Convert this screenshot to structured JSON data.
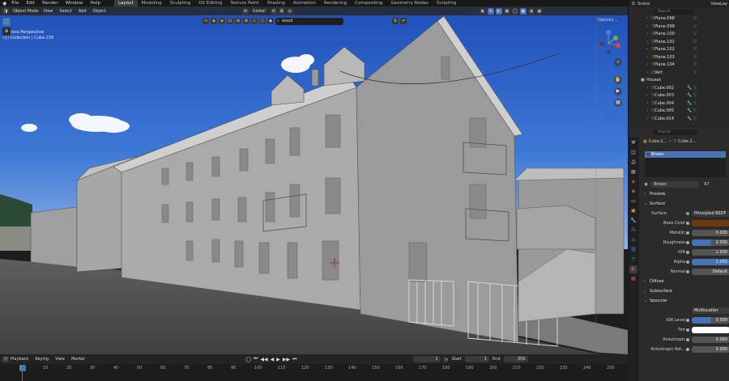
{
  "app": {
    "menus": [
      "File",
      "Edit",
      "Render",
      "Window",
      "Help"
    ],
    "workspaces": [
      "Layout",
      "Modeling",
      "Sculpting",
      "UV Editing",
      "Texture Paint",
      "Shading",
      "Animation",
      "Rendering",
      "Compositing",
      "Geometry Nodes",
      "Scripting"
    ],
    "active_workspace": "Layout",
    "scene_label": "Scene",
    "viewlayer_label": "ViewLay"
  },
  "viewport": {
    "mode": "Object Mode",
    "menus": [
      "View",
      "Select",
      "Add",
      "Object"
    ],
    "transform_orientation": "Global",
    "search_value": "wood",
    "view_name": "Camera Perspective",
    "collection_info": "(1) Collection | Cube.239",
    "options_label": "Options"
  },
  "timeline": {
    "menus": [
      "Playback",
      "Keying",
      "View",
      "Marker"
    ],
    "current_frame": "1",
    "start_label": "Start",
    "start_value": "1",
    "end_label": "End",
    "end_value": "250",
    "ticks": [
      "1",
      "10",
      "20",
      "30",
      "40",
      "50",
      "60",
      "70",
      "80",
      "90",
      "100",
      "110",
      "120",
      "130",
      "140",
      "150",
      "160",
      "170",
      "180",
      "190",
      "200",
      "210",
      "220",
      "230",
      "240",
      "250"
    ]
  },
  "outliner": {
    "objects_top": [
      "Plane.098",
      "Plane.099",
      "Plane.100",
      "Plane.101",
      "Plane.102",
      "Plane.103",
      "Plane.104",
      "Vert"
    ],
    "collection_name": "Houses",
    "objects_houses": [
      "Cube.002",
      "Cube.003",
      "Cube.004",
      "Cube.005",
      "Cube.014"
    ],
    "search_placeholder": "Search"
  },
  "properties": {
    "search_placeholder": "Search",
    "breadcrumb_object": "Cube.2...",
    "breadcrumb_mesh": "Cube.2...",
    "material_slot": "Brown",
    "material_name": "Brown",
    "user_count": "67",
    "sections": {
      "preview": "Preview",
      "surface": "Surface",
      "diffuse": "Diffuse",
      "subsurface": "Subsurface",
      "specular": "Specular"
    },
    "surface_shader": "Principled BSDF",
    "fields": [
      {
        "label": "Base Color",
        "value": "",
        "fill": 0,
        "kind": "color",
        "color": "#6b3b10"
      },
      {
        "label": "Metallic",
        "value": "0.000",
        "fill": 0,
        "kind": "value"
      },
      {
        "label": "Roughness",
        "value": "0.500",
        "fill": 50,
        "kind": "value"
      },
      {
        "label": "IOR",
        "value": "1.500",
        "fill": 0,
        "kind": "value"
      },
      {
        "label": "Alpha",
        "value": "1.000",
        "fill": 100,
        "kind": "value"
      },
      {
        "label": "Normal",
        "value": "Default",
        "fill": 0,
        "kind": "value"
      }
    ],
    "specular_distribution": "Multiscatter GGX",
    "specular_fields": [
      {
        "label": "IOR Level",
        "value": "0.500",
        "fill": 50,
        "kind": "value"
      },
      {
        "label": "Tint",
        "value": "",
        "fill": 0,
        "kind": "color",
        "color": "#ffffff"
      },
      {
        "label": "Anisotropic",
        "value": "0.000",
        "fill": 0,
        "kind": "value"
      },
      {
        "label": "Anisotropic Rot...",
        "value": "0.000",
        "fill": 0,
        "kind": "value"
      }
    ]
  },
  "colors": {
    "accent_blue": "#4772b3",
    "mesh_orange": "#e69b35",
    "filter_green": "#5ec45e"
  }
}
